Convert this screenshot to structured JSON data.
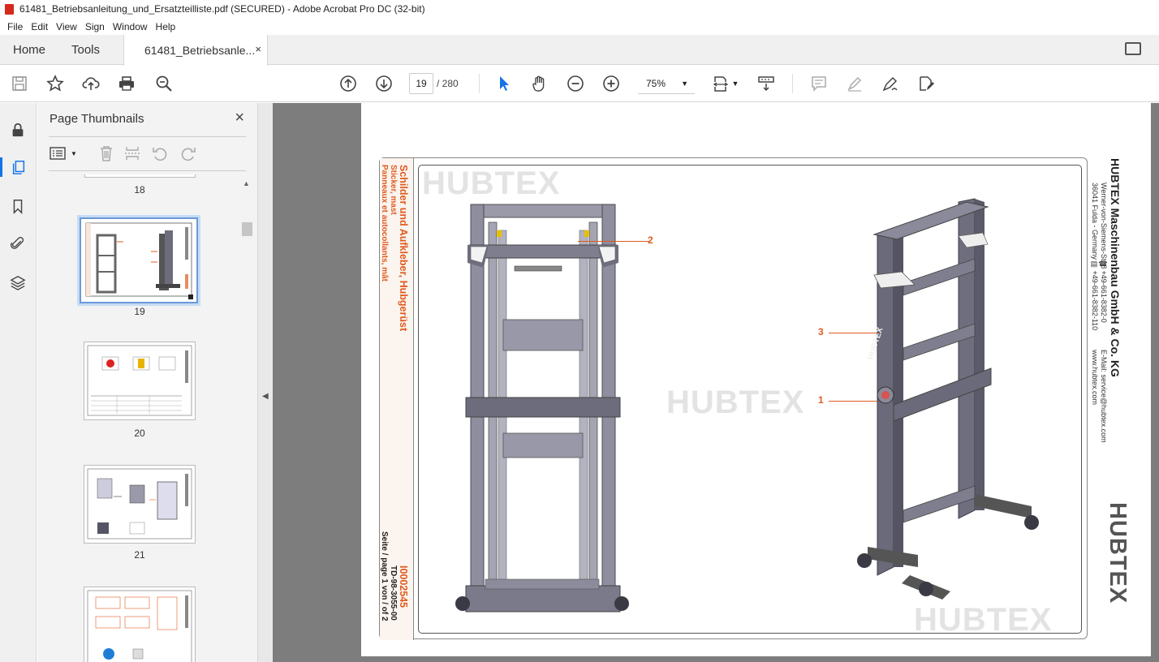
{
  "window": {
    "title": "61481_Betriebsanleitung_und_Ersatzteilliste.pdf (SECURED) - Adobe Acrobat Pro DC (32-bit)"
  },
  "menu": [
    "File",
    "Edit",
    "View",
    "Sign",
    "Window",
    "Help"
  ],
  "tabs": {
    "home": "Home",
    "tools": "Tools",
    "doc": "61481_Betriebsanle...",
    "close": "×"
  },
  "toolbar": {
    "page_current": "19",
    "page_total": "/ 280",
    "zoom": "75%"
  },
  "panel": {
    "title": "Page Thumbnails",
    "close": "×",
    "thumbs": [
      {
        "label": "18"
      },
      {
        "label": "19"
      },
      {
        "label": "20"
      },
      {
        "label": "21"
      }
    ]
  },
  "document": {
    "company": "HUBTEX Maschinenbau GmbH & Co. KG",
    "address1": "Werner-von-Siemens-St. 8",
    "address2": "36041 Fulda - Germany",
    "phone": "☎ +49-661-8382-0",
    "fax": "▤ +49-661-8382-110",
    "email": "E-Mail: service@hubtex.com",
    "web": "www.hubtex.com",
    "logo": "HUBTEX",
    "title_de": "Schilder und Aufkleber, Hubgerüst",
    "title_en": "Sticker, mast",
    "title_fr": "Panneaux et autocollants, mât",
    "doc_id": "I0002545",
    "drawing_no": "TD-98-3055-00",
    "page_info": "Seite / page 1 von / of 2",
    "callouts": [
      "1",
      "2",
      "3"
    ],
    "watermark": "HUBTEX"
  },
  "colors": {
    "accent": "#1473e6",
    "brand_orange": "#e05b1f"
  }
}
